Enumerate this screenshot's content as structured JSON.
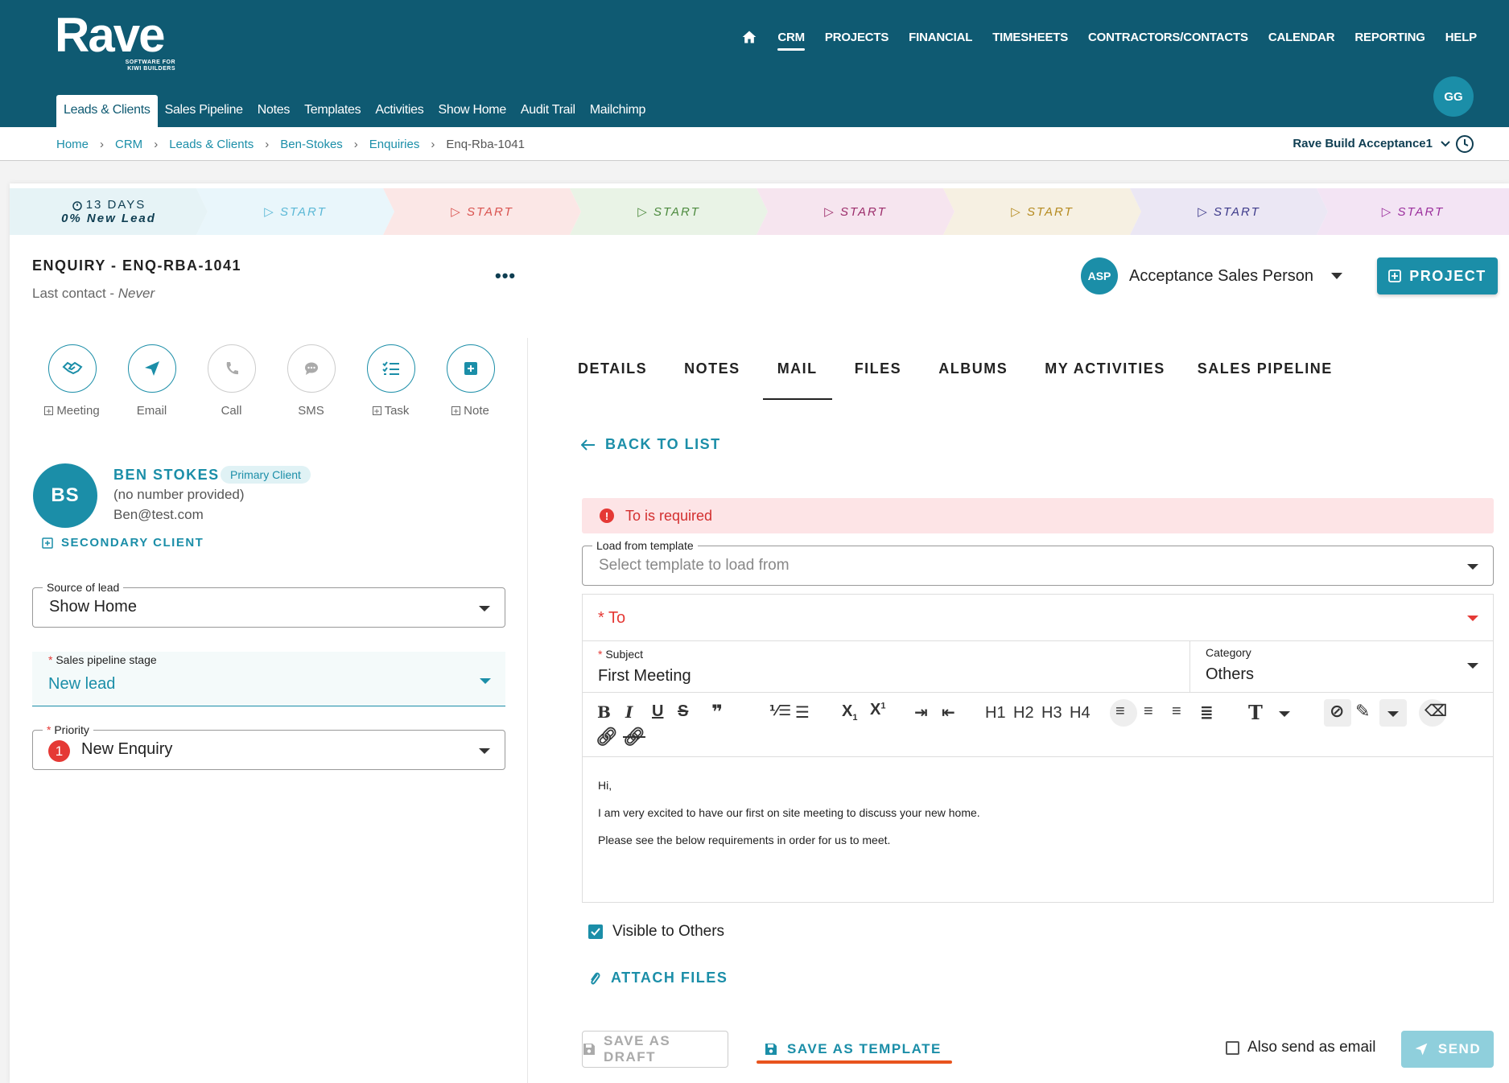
{
  "brand": {
    "name": "Rave",
    "tagline_1": "SOFTWARE FOR",
    "tagline_2": "KIWI BUILDERS"
  },
  "main_nav": [
    "CRM",
    "PROJECTS",
    "FINANCIAL",
    "TIMESHEETS",
    "CONTRACTORS/CONTACTS",
    "CALENDAR",
    "REPORTING",
    "HELP"
  ],
  "user": {
    "initials": "GG"
  },
  "sub_nav": [
    "Leads & Clients",
    "Sales Pipeline",
    "Notes",
    "Templates",
    "Activities",
    "Show Home",
    "Audit Trail",
    "Mailchimp"
  ],
  "breadcrumb": [
    "Home",
    "CRM",
    "Leads & Clients",
    "Ben-Stokes",
    "Enquiries",
    "Enq-Rba-1041"
  ],
  "account": "Rave Build Acceptance1",
  "stages": {
    "first_days": "13 DAYS",
    "first_status": "0% New Lead",
    "start_label": "START"
  },
  "enquiry": {
    "title": "ENQUIRY - ENQ-RBA-1041",
    "last_contact_label": "Last contact - ",
    "last_contact_value": "Never"
  },
  "sales_person": {
    "initials": "ASP",
    "name": "Acceptance Sales Person"
  },
  "project_button": "PROJECT",
  "actions": [
    "Meeting",
    "Email",
    "Call",
    "SMS",
    "Task",
    "Note"
  ],
  "client": {
    "initials": "BS",
    "name": "BEN STOKES",
    "badge": "Primary Client",
    "phone": "(no number provided)",
    "email": "Ben@test.com",
    "secondary_label": "SECONDARY CLIENT"
  },
  "fields": {
    "source_label": "Source of lead",
    "source_value": "Show Home",
    "stage_label": "Sales pipeline stage",
    "stage_value": "New lead",
    "priority_label": "Priority",
    "priority_number": "1",
    "priority_value": "New Enquiry"
  },
  "tabs": [
    "DETAILS",
    "NOTES",
    "MAIL",
    "FILES",
    "ALBUMS",
    "MY ACTIVITIES",
    "SALES PIPELINE"
  ],
  "active_tab": "MAIL",
  "mail": {
    "back_label": "BACK TO LIST",
    "alert": "To is required",
    "template_label": "Load from template",
    "template_placeholder": "Select template to load from",
    "to_label": "To",
    "subject_label": "Subject",
    "subject_value": "First Meeting",
    "category_label": "Category",
    "category_value": "Others",
    "toolbar_headings": [
      "H1",
      "H2",
      "H3",
      "H4"
    ],
    "body": [
      "Hi,",
      "I am very excited to have our first on site meeting to discuss your new home.",
      "Please see the below requirements in order for us to meet."
    ],
    "visible_label": "Visible to Others",
    "attach_label": "ATTACH FILES",
    "draft_label": "SAVE AS DRAFT",
    "template_save_label": "SAVE AS TEMPLATE",
    "also_send_label": "Also send as email",
    "send_label": "SEND"
  },
  "colors": {
    "header": "#0f5a72",
    "accent": "#1b8ea8",
    "error": "#e53935",
    "annotation": "#e8541e"
  }
}
